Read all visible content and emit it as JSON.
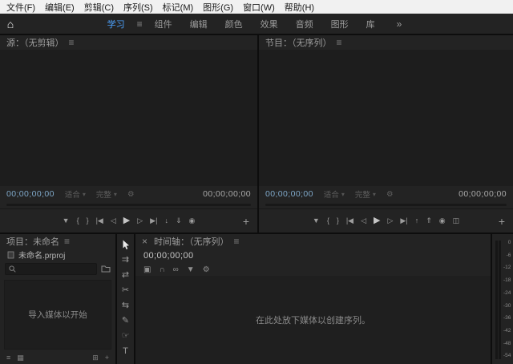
{
  "colors": {
    "accent": "#4da3ff",
    "menubar_bg": "#f1f1f1",
    "panel_bg": "#232323",
    "viewer_bg": "#1d1d1d"
  },
  "menu_bar": {
    "items": [
      "文件(F)",
      "编辑(E)",
      "剪辑(C)",
      "序列(S)",
      "标记(M)",
      "图形(G)",
      "窗口(W)",
      "帮助(H)"
    ]
  },
  "workspace_bar": {
    "home_icon": "⌂",
    "active_tab": "学习",
    "panel_menu_icon": "≡",
    "tabs": [
      "组件",
      "编辑",
      "颜色",
      "效果",
      "音频",
      "图形",
      "库"
    ],
    "overflow_icon": "»"
  },
  "source_monitor": {
    "title": "源：（无剪辑）",
    "panel_menu_icon": "≡",
    "current_timecode": "00;00;00;00",
    "duration_timecode": "00;00;00;00",
    "zoom_level": "适合",
    "playback_resolution": "完整",
    "dropdown_caret": "▾",
    "settings_icon": "⚙",
    "transport": {
      "add_marker": "▼",
      "mark_in": "{",
      "mark_out": "}",
      "go_to_in": "|◀",
      "step_back": "◁",
      "play": "▶",
      "step_forward": "▷",
      "go_to_out": "▶|",
      "insert": "↓",
      "overwrite": "⇓",
      "export_frame": "◉",
      "button_editor": "+"
    }
  },
  "program_monitor": {
    "title": "节目：（无序列）",
    "panel_menu_icon": "≡",
    "current_timecode": "00;00;00;00",
    "duration_timecode": "00;00;00;00",
    "zoom_level": "适合",
    "playback_resolution": "完整",
    "dropdown_caret": "▾",
    "settings_icon": "⚙",
    "transport": {
      "add_marker": "▼",
      "mark_in": "{",
      "mark_out": "}",
      "go_to_in": "|◀",
      "step_back": "◁",
      "play": "▶",
      "step_forward": "▷",
      "go_to_out": "▶|",
      "lift": "↑",
      "extract": "⇑",
      "export_frame": "◉",
      "comparison_view": "◫",
      "button_editor": "+"
    }
  },
  "project_panel": {
    "title": "项目：未命名",
    "panel_menu_icon": "≡",
    "file_tab": "未命名.prproj",
    "search_placeholder": "",
    "empty_text": "导入媒体以开始",
    "footer": {
      "list_view": "≡",
      "icon_view": "▦",
      "new_bin": "⊞",
      "new_item": "+"
    }
  },
  "tools_panel": {
    "track_select_forward": "⇉",
    "ripple_edit": "⇄",
    "razor": "✂",
    "slip": "⇆",
    "pen": "✎",
    "hand": "☞",
    "type": "T"
  },
  "timeline_panel": {
    "close_icon": "×",
    "title": "时间轴：（无序列）",
    "panel_menu_icon": "≡",
    "timecode": "00;00;00;00",
    "toolbar": {
      "nest_toggle": "▣",
      "snap": "∩",
      "linked_selection": "∞",
      "add_marker": "▼",
      "display_settings": "⚙"
    },
    "empty_text": "在此处放下媒体以创建序列。"
  },
  "audio_meter": {
    "scale": [
      "0",
      "-6",
      "-12",
      "-18",
      "-24",
      "-30",
      "-36",
      "-42",
      "-48",
      "-54"
    ]
  }
}
